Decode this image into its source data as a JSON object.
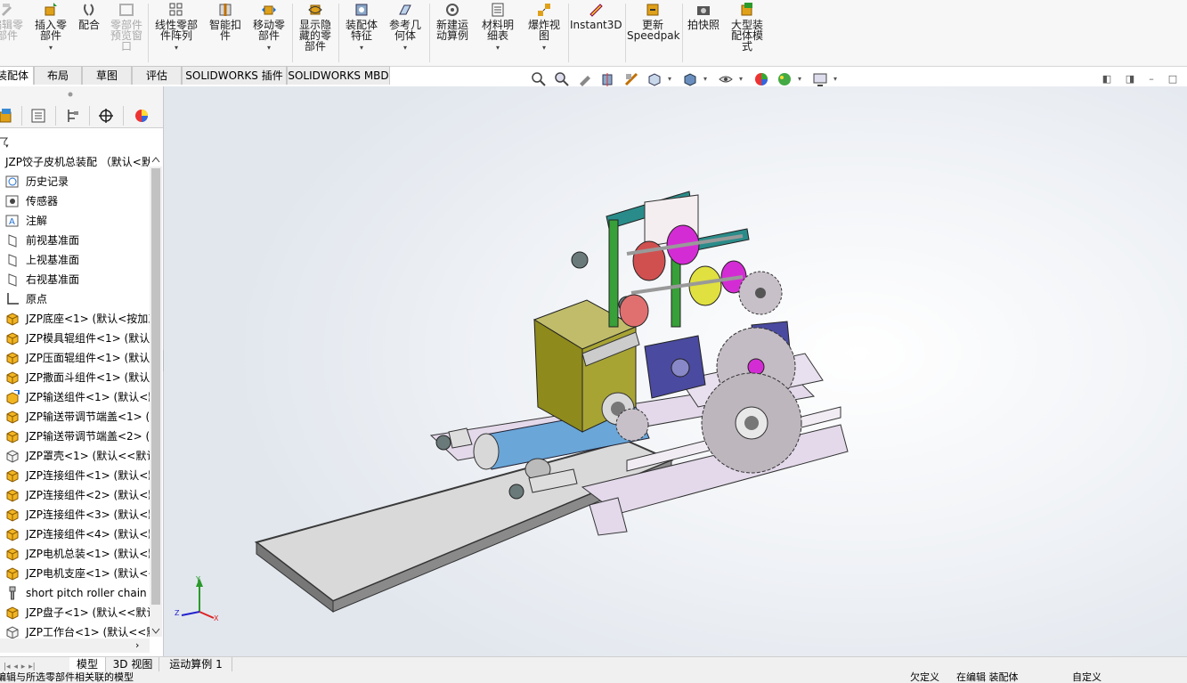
{
  "ribbon": {
    "buttons": [
      {
        "label": "编辑零\n部件",
        "icon": "edit-part-icon",
        "disabled": true
      },
      {
        "label": "插入零\n部件",
        "icon": "insert-part-icon",
        "disabled": false
      },
      {
        "label": "配合",
        "icon": "mate-icon",
        "disabled": false
      },
      {
        "label": "零部件\n预览窗\n口",
        "icon": "preview-window-icon",
        "disabled": true
      },
      {
        "label": "线性零部\n件阵列",
        "icon": "linear-pattern-icon",
        "disabled": false
      },
      {
        "label": "智能扣\n件",
        "icon": "smart-fastener-icon",
        "disabled": false
      },
      {
        "label": "移动零\n部件",
        "icon": "move-part-icon",
        "disabled": false
      },
      {
        "label": "显示隐\n藏的零\n部件",
        "icon": "show-hidden-icon",
        "disabled": false
      },
      {
        "label": "装配体\n特征",
        "icon": "assembly-feature-icon",
        "disabled": false
      },
      {
        "label": "参考几\n何体",
        "icon": "reference-geometry-icon",
        "disabled": false
      },
      {
        "label": "新建运\n动算例",
        "icon": "motion-study-icon",
        "disabled": false
      },
      {
        "label": "材料明\n细表",
        "icon": "bom-icon",
        "disabled": false
      },
      {
        "label": "爆炸视\n图",
        "icon": "exploded-view-icon",
        "disabled": false
      },
      {
        "label": "Instant3D",
        "icon": "instant3d-icon",
        "disabled": false
      },
      {
        "label": "更新\nSpeedpak",
        "icon": "speedpak-icon",
        "disabled": false
      },
      {
        "label": "拍快照",
        "icon": "snapshot-icon",
        "disabled": false
      },
      {
        "label": "大型装\n配体模\n式",
        "icon": "large-assembly-icon",
        "disabled": false
      }
    ]
  },
  "tabs": [
    {
      "label": "装配体",
      "active": true
    },
    {
      "label": "布局",
      "active": false
    },
    {
      "label": "草图",
      "active": false
    },
    {
      "label": "评估",
      "active": false
    },
    {
      "label": "SOLIDWORKS 插件",
      "active": false
    },
    {
      "label": "SOLIDWORKS MBD",
      "active": false
    }
  ],
  "tree": {
    "root": "JZP饺子皮机总装配 （默认<默",
    "items": [
      {
        "label": "历史记录",
        "icon": "history-icon"
      },
      {
        "label": "传感器",
        "icon": "sensor-icon"
      },
      {
        "label": "注解",
        "icon": "annotation-icon"
      },
      {
        "label": "前视基准面",
        "icon": "plane-icon"
      },
      {
        "label": "上视基准面",
        "icon": "plane-icon"
      },
      {
        "label": "右视基准面",
        "icon": "plane-icon"
      },
      {
        "label": "原点",
        "icon": "origin-icon"
      },
      {
        "label": "JZP底座<1> (默认<按加工",
        "icon": "subassembly-icon"
      },
      {
        "label": "JZP模具辊组件<1> (默认",
        "icon": "subassembly-icon"
      },
      {
        "label": "JZP压面辊组件<1> (默认",
        "icon": "subassembly-icon"
      },
      {
        "label": "JZP撒面斗组件<1> (默认",
        "icon": "subassembly-icon"
      },
      {
        "label": "JZP输送组件<1> (默认<默",
        "icon": "subassembly-edit-icon"
      },
      {
        "label": "JZP输送带调节端盖<1> (",
        "icon": "subassembly-icon"
      },
      {
        "label": "JZP输送带调节端盖<2> (",
        "icon": "subassembly-icon"
      },
      {
        "label": "JZP罩壳<1> (默认<<默认",
        "icon": "part-icon"
      },
      {
        "label": "JZP连接组件<1> (默认<默",
        "icon": "subassembly-icon"
      },
      {
        "label": "JZP连接组件<2> (默认<默",
        "icon": "subassembly-icon"
      },
      {
        "label": "JZP连接组件<3> (默认<默",
        "icon": "subassembly-icon"
      },
      {
        "label": "JZP连接组件<4> (默认<默",
        "icon": "subassembly-icon"
      },
      {
        "label": "JZP电机总装<1> (默认<默",
        "icon": "subassembly-icon"
      },
      {
        "label": "JZP电机支座<1> (默认<<",
        "icon": "subassembly-icon"
      },
      {
        "label": "short pitch roller chain w",
        "icon": "toolbox-part-icon"
      },
      {
        "label": "JZP盘子<1> (默认<<默认",
        "icon": "subassembly-icon"
      },
      {
        "label": "JZP工作台<1> (默认<<默",
        "icon": "part-icon"
      }
    ]
  },
  "bottom_tabs": [
    {
      "label": "模型",
      "active": true
    },
    {
      "label": "3D 视图",
      "active": false
    },
    {
      "label": "运动算例 1",
      "active": false
    }
  ],
  "status": {
    "left": "编辑与所选零部件相关联的模型",
    "undefined": "欠定义",
    "editing": "在编辑 装配体",
    "custom": "自定义"
  },
  "triad": {
    "x": "X",
    "y": "Y",
    "z": "Z"
  },
  "colors": {
    "ribbon_bg": "#f7f7f7",
    "frame_purple": "#e3d9ea",
    "hopper_olive": "#8e8a1c",
    "belt_blue": "#6aa6d8",
    "plate_teal": "#2a8c8a",
    "bracket_green": "#38a038",
    "roller_magenta": "#d42cd4",
    "gear_grey": "#bdb6bd",
    "bearing_navy": "#4a4aa0"
  }
}
